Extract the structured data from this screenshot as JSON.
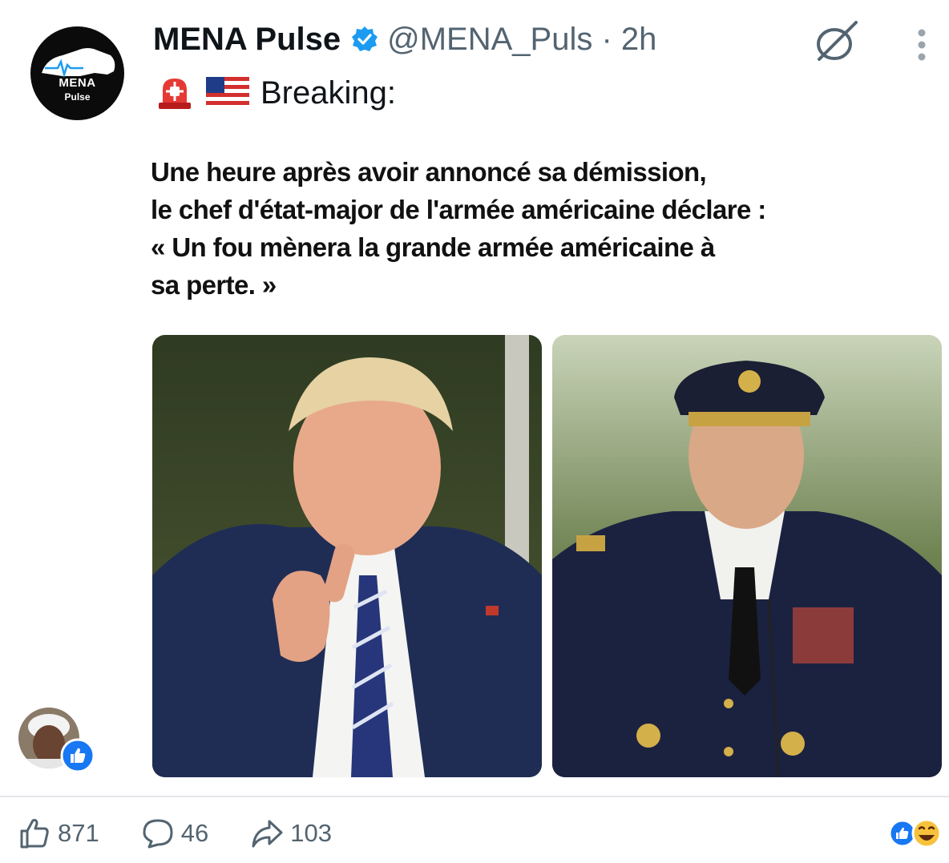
{
  "post": {
    "avatar": {
      "line1": "MENA",
      "line2": "Pulse"
    },
    "author_name": "MENA Pulse",
    "handle_time": "@MENA_Puls · 2h",
    "breaking_label": "Breaking:",
    "icons": [
      "verified-badge-icon",
      "siren-icon",
      "us-flag-icon",
      "no-symbol-icon",
      "more-options-icon"
    ]
  },
  "caption": {
    "line1": "Une heure après avoir annoncé sa démission,",
    "line2": "le chef d'état-major de l'armée américaine déclare :",
    "line3": "« Un fou mènera la grande armée américaine à",
    "line4": "sa perte. »"
  },
  "footer": {
    "likes": "871",
    "comments": "46",
    "shares": "103",
    "icons": [
      "like-icon",
      "comment-icon",
      "share-icon",
      "reactions-icon"
    ]
  },
  "colors": {
    "verified": "#1d9bf0",
    "like_blue": "#1877f2",
    "text_secondary": "#536471"
  }
}
